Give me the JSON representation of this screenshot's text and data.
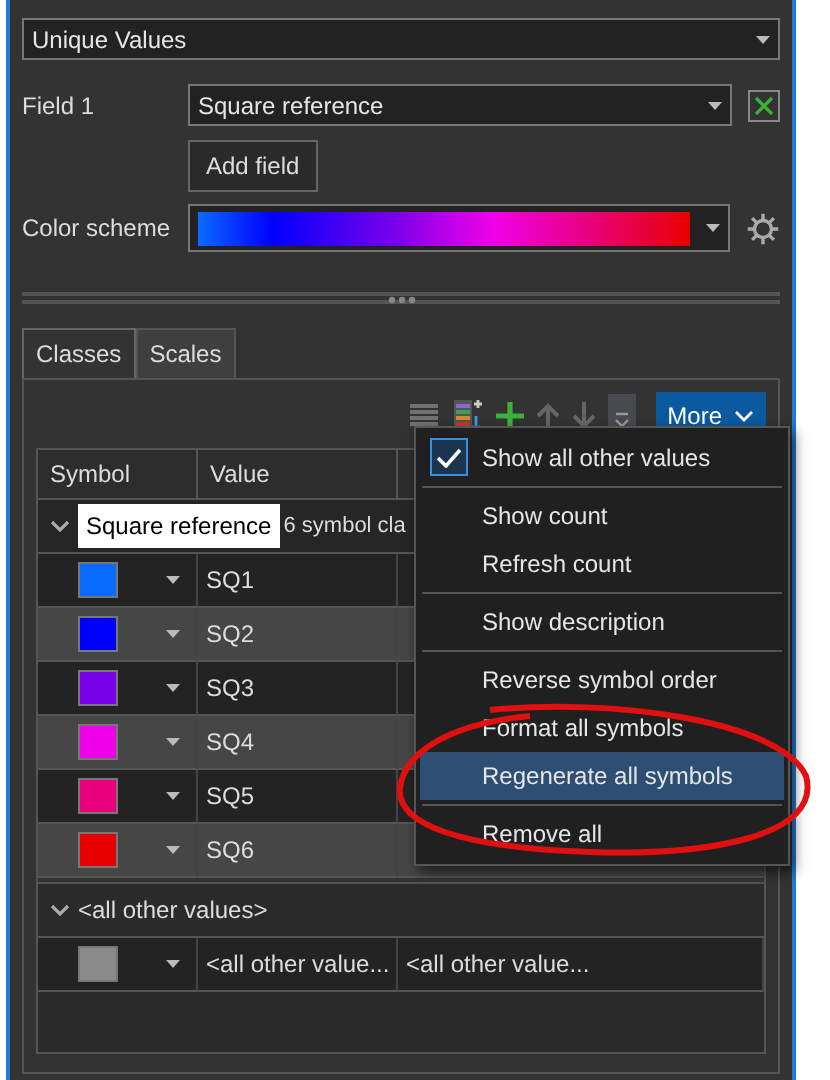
{
  "symbology": {
    "method": "Unique Values"
  },
  "field_1": {
    "label": "Field 1",
    "value": "Square reference"
  },
  "add_field": "Add field",
  "color_scheme": {
    "label": "Color scheme"
  },
  "tabs": [
    {
      "label": "Classes",
      "selected": true
    },
    {
      "label": "Scales",
      "selected": false
    }
  ],
  "toolbar": [
    {
      "kind": "list",
      "disabled": true
    },
    {
      "kind": "add-values",
      "disabled": false
    },
    {
      "kind": "add",
      "disabled": false
    },
    {
      "kind": "up",
      "disabled": true
    },
    {
      "kind": "down",
      "disabled": true
    },
    {
      "kind": "more-menu",
      "disabled": false
    }
  ],
  "more_button": "More",
  "table": {
    "columns": [
      "Symbol",
      "Value"
    ],
    "group": {
      "heading": "Square reference",
      "count": "6 symbol cla"
    },
    "rows": [
      {
        "color": "#0a6cff",
        "value": "SQ1"
      },
      {
        "color": "#0000ff",
        "value": "SQ2"
      },
      {
        "color": "#7a00ea",
        "value": "SQ3"
      },
      {
        "color": "#f000e8",
        "value": "SQ4"
      },
      {
        "color": "#e8007a",
        "value": "SQ5"
      },
      {
        "color": "#e80000",
        "value": "SQ6"
      }
    ],
    "other_group": {
      "heading": "<all other values>",
      "color": "#8a8a8a",
      "value": "<all other value...",
      "label": "<all other value..."
    }
  },
  "menu": [
    [
      {
        "label": "Show all other values",
        "checked": true,
        "selected": false
      }
    ],
    [
      {
        "label": "Show count",
        "checked": false,
        "selected": false
      },
      {
        "label": "Refresh count",
        "checked": false,
        "selected": false
      }
    ],
    [
      {
        "label": "Show description",
        "checked": false,
        "selected": false
      }
    ],
    [
      {
        "label": "Reverse symbol order",
        "checked": false,
        "selected": false
      },
      {
        "label": "Format all symbols",
        "checked": false,
        "selected": false
      },
      {
        "label": "Regenerate all symbols",
        "checked": false,
        "selected": true
      }
    ],
    [
      {
        "label": "Remove all",
        "checked": false,
        "selected": false
      }
    ]
  ]
}
